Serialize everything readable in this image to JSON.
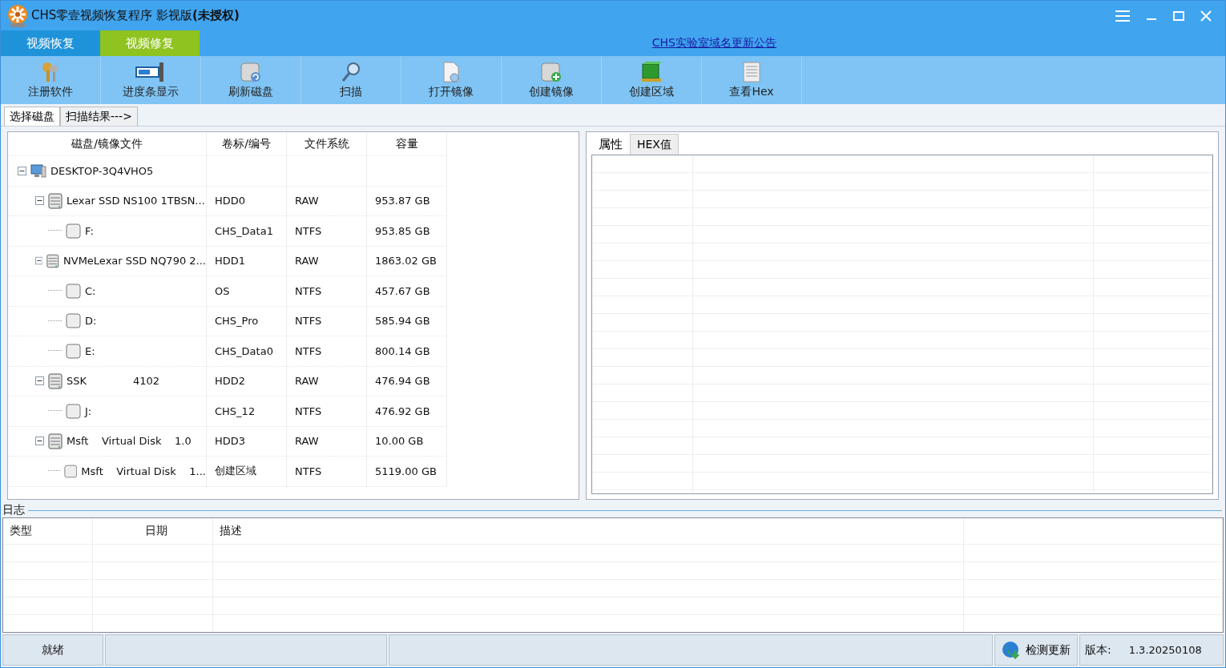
{
  "window": {
    "title_prefix": "CHS零壹视频恢复程序 影视版",
    "title_suffix": "(未授权)"
  },
  "mode_tabs": [
    {
      "label": "视频恢复",
      "selected": true
    },
    {
      "label": "视频修复",
      "selected": false
    }
  ],
  "announcement_link": "CHS实验室域名更新公告",
  "toolbar": [
    {
      "label": "注册软件",
      "kind": "keys"
    },
    {
      "label": "进度条显示",
      "kind": "progress"
    },
    {
      "label": "刷新磁盘",
      "kind": "refresh"
    },
    {
      "label": "扫描",
      "kind": "scan"
    },
    {
      "label": "打开镜像",
      "kind": "open"
    },
    {
      "label": "创建镜像",
      "kind": "create"
    },
    {
      "label": "创建区域",
      "kind": "region"
    },
    {
      "label": "查看Hex",
      "kind": "hex"
    }
  ],
  "view_tabs": [
    {
      "label": "选择磁盘",
      "selected": true
    },
    {
      "label": "扫描结果--->",
      "selected": false
    }
  ],
  "disk_table": {
    "columns": [
      "磁盘/镜像文件",
      "卷标/编号",
      "文件系统",
      "容量"
    ],
    "tree": [
      {
        "name": "DESKTOP-3Q4VHO5",
        "kind": "computer",
        "expanded": true,
        "children": [
          {
            "name": "Lexar SSD NS100 1TBSN...",
            "label": "HDD0",
            "fs": "RAW",
            "capacity": "953.87 GB",
            "kind": "disk",
            "expanded": true,
            "children": [
              {
                "name": "F:",
                "label": "CHS_Data1",
                "fs": "NTFS",
                "capacity": "953.85 GB",
                "kind": "partition",
                "checked": false
              }
            ]
          },
          {
            "name": "NVMeLexar SSD NQ790 2...",
            "label": "HDD1",
            "fs": "RAW",
            "capacity": "1863.02 GB",
            "kind": "disk",
            "expanded": true,
            "children": [
              {
                "name": "C:",
                "label": "OS",
                "fs": "NTFS",
                "capacity": "457.67 GB",
                "kind": "partition",
                "checked": false
              },
              {
                "name": "D:",
                "label": "CHS_Pro",
                "fs": "NTFS",
                "capacity": "585.94 GB",
                "kind": "partition",
                "checked": false
              },
              {
                "name": "E:",
                "label": "CHS_Data0",
                "fs": "NTFS",
                "capacity": "800.14 GB",
                "kind": "partition",
                "checked": false
              }
            ]
          },
          {
            "name": "SSK              4102",
            "label": "HDD2",
            "fs": "RAW",
            "capacity": "476.94 GB",
            "kind": "disk",
            "expanded": true,
            "children": [
              {
                "name": "J:",
                "label": "CHS_12",
                "fs": "NTFS",
                "capacity": "476.92 GB",
                "kind": "partition",
                "checked": false
              }
            ]
          },
          {
            "name": "Msft    Virtual Disk    1.0",
            "label": "HDD3",
            "fs": "RAW",
            "capacity": "10.00 GB",
            "kind": "disk",
            "expanded": true,
            "children": [
              {
                "name": "Msft    Virtual Disk    1...",
                "label": "创建区域",
                "fs": "NTFS",
                "capacity": "5119.00 GB",
                "kind": "partition",
                "checked": false
              }
            ]
          }
        ]
      }
    ]
  },
  "detail_tabs": [
    {
      "label": "属性",
      "selected": true
    },
    {
      "label": "HEX值",
      "selected": false
    }
  ],
  "log": {
    "title": "日志",
    "columns": [
      "类型",
      "日期",
      "描述"
    ]
  },
  "status_bar": {
    "status": "就绪",
    "update_button": "检测更新",
    "version_label": "版本:",
    "version": "1.3.20250108"
  }
}
